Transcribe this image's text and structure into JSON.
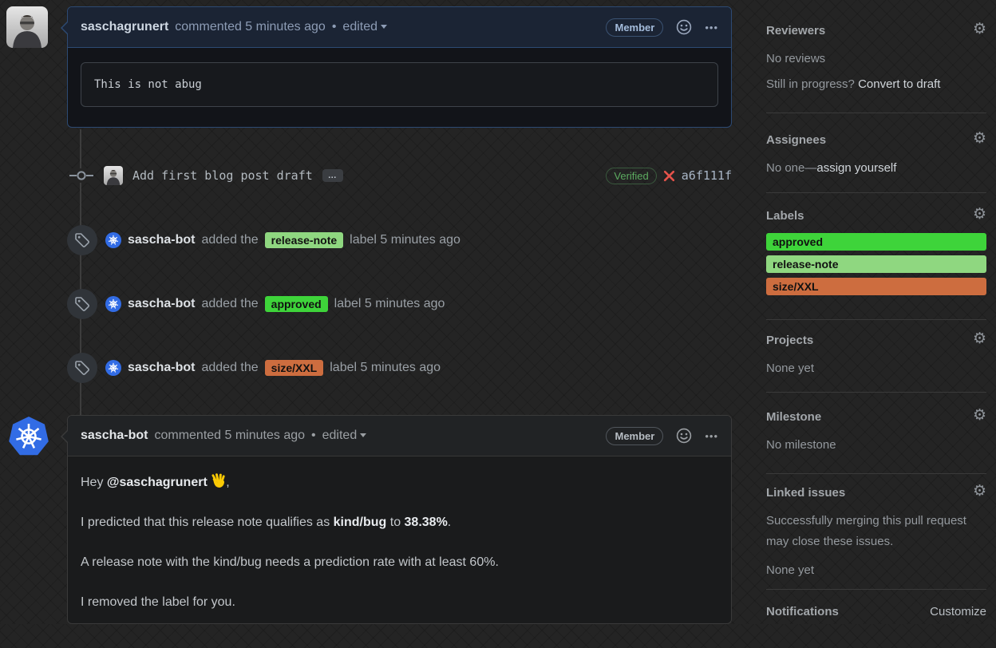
{
  "comment1": {
    "author": "saschagrunert",
    "action": "commented 5 minutes ago",
    "bullet": "•",
    "edited": "edited",
    "badge": "Member",
    "code": "This is not abug"
  },
  "commit": {
    "message": "Add first blog post draft",
    "expander": "…",
    "verified": "Verified",
    "sha": "a6f111f"
  },
  "label_events": [
    {
      "actor": "sascha-bot",
      "action": "added the",
      "label": "release-note",
      "color": "#8fd780",
      "suffix": "label 5 minutes ago"
    },
    {
      "actor": "sascha-bot",
      "action": "added the",
      "label": "approved",
      "color": "#3ed43a",
      "suffix": "label 5 minutes ago"
    },
    {
      "actor": "sascha-bot",
      "action": "added the",
      "label": "size/XXL",
      "color": "#cd6d3f",
      "suffix": "label 5 minutes ago"
    }
  ],
  "comment2": {
    "author": "sascha-bot",
    "action": "commented 5 minutes ago",
    "bullet": "•",
    "edited": "edited",
    "badge": "Member",
    "greeting_prefix": "Hey ",
    "mention": "@saschagrunert",
    "wave_emoji": "👋",
    "greeting_suffix": ",",
    "p2_prefix": "I predicted that this release note qualifies as ",
    "p2_kind": "kind/bug",
    "p2_mid": " to ",
    "p2_rate": "38.38%",
    "p2_suffix": ".",
    "p3": "A release note with the kind/bug needs a prediction rate with at least 60%.",
    "p4": "I removed the label for you."
  },
  "sidebar": {
    "reviewers": {
      "title": "Reviewers",
      "empty": "No reviews",
      "hint": "Still in progress? ",
      "hint_link": "Convert to draft"
    },
    "assignees": {
      "title": "Assignees",
      "empty_prefix": "No one—",
      "empty_link": "assign yourself"
    },
    "labels": {
      "title": "Labels",
      "items": [
        {
          "name": "approved",
          "color": "#3ed43a"
        },
        {
          "name": "release-note",
          "color": "#8fd780"
        },
        {
          "name": "size/XXL",
          "color": "#cd6d3f"
        }
      ]
    },
    "projects": {
      "title": "Projects",
      "empty": "None yet"
    },
    "milestone": {
      "title": "Milestone",
      "empty": "No milestone"
    },
    "linked_issues": {
      "title": "Linked issues",
      "description": "Successfully merging this pull request may close these issues.",
      "empty": "None yet"
    },
    "notifications": {
      "title": "Notifications",
      "link": "Customize"
    }
  },
  "icons": {
    "gear": "⚙",
    "kebab": "•••"
  },
  "colors": {
    "accent_blue": "#2d4a73",
    "header1_bg": "#1b2434",
    "verified_green": "#5cab60",
    "error_red": "#e5534b",
    "k8s_blue": "#326ce5",
    "label_text": "#111111"
  }
}
